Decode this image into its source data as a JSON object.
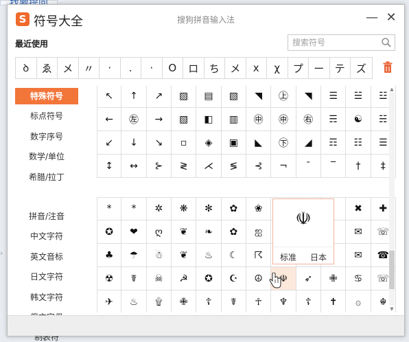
{
  "background": {
    "link_text": "找要提问",
    "accent": "#2a5db0"
  },
  "window": {
    "logo_letter": "S",
    "app_title": "符号大全",
    "center_title": "搜狗拼音输入法",
    "minimize": "—",
    "close": "✕",
    "accent_color": "#f2753a"
  },
  "recent": {
    "label": "最近使用",
    "items": [
      "ꝺ",
      "ゑ",
      "メ",
      "〃",
      "·",
      ".",
      "·",
      "O",
      "ロ",
      "ち",
      "メ",
      "x",
      "χ",
      "プ",
      "ー",
      "テ",
      "ズ"
    ],
    "trash_icon": "trash-icon"
  },
  "search": {
    "placeholder": "搜索符号",
    "icon": "search-icon"
  },
  "sidebar": {
    "items_top": [
      "特殊符号",
      "标点符号",
      "数字序号",
      "数学/单位",
      "希腊/拉丁"
    ],
    "items_bottom": [
      "拼音/注音",
      "中文字符",
      "英文音标",
      "日文字符",
      "韩文字符",
      "俄文字母",
      "制表符"
    ],
    "active_index": 0
  },
  "grid_top": [
    [
      "↖",
      "↑",
      "↗",
      "▨",
      "▤",
      "▧",
      "◥",
      "㊤",
      "◥",
      "☰",
      "☱",
      "☳"
    ],
    [
      "←",
      "㊧",
      "→",
      "▧",
      "◧",
      "▥",
      "㊥",
      "㊥",
      "㊨",
      "☴",
      "☯",
      "☵"
    ],
    [
      "↙",
      "↓",
      "↘",
      "▫",
      "◈",
      "▣",
      "◣",
      "㊦",
      "◢",
      "☶",
      "☷",
      "☰"
    ],
    [
      "↕",
      "↔",
      "⊱",
      "≷",
      "⋌",
      "≶",
      "⊰",
      "¬",
      "¯",
      "‾",
      "†",
      "‡"
    ]
  ],
  "grid_bottom": [
    [
      "*",
      "*",
      "✲",
      "❋",
      "✻",
      "✿",
      "❀",
      "❁",
      "",
      "",
      "✖",
      "✚"
    ],
    [
      "✪",
      "❤",
      "ღ",
      "❦",
      "❧",
      "✿",
      "ஐ",
      "ℤ",
      "",
      "",
      "✉",
      "☏"
    ],
    [
      "♣",
      "☂",
      "☃",
      "❦",
      "♨",
      "☾",
      "☈",
      "☡",
      "",
      "",
      "✉",
      "☎"
    ],
    [
      "☢",
      "☤",
      "☠",
      "☭",
      "✪",
      "☪",
      "☮",
      "☫",
      "➶",
      "✙",
      "♋",
      "☏"
    ],
    [
      "✈",
      "♨",
      "۩",
      "✙",
      "☦",
      "☤",
      "☥",
      "♆",
      "☦",
      "✝",
      "۞",
      "☬"
    ]
  ],
  "preview": {
    "glyph": "☫",
    "standard_label": "标准",
    "japanese_label": "日本"
  }
}
